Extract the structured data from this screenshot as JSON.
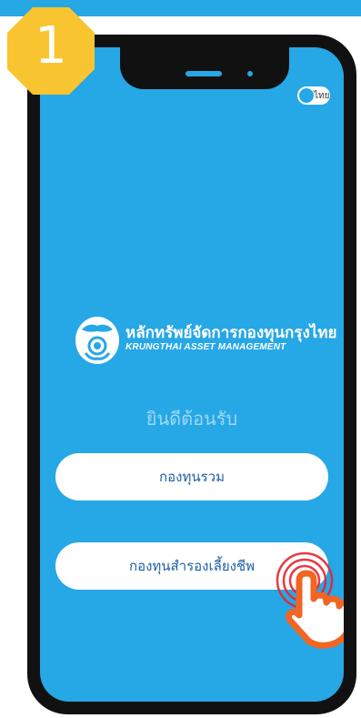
{
  "step": {
    "number": "1"
  },
  "header": {
    "language_toggle": "ไทย"
  },
  "brand": {
    "name_th": "หลักทรัพย์จัดการกองทุนกรุงไทย",
    "name_en": "KRUNGTHAI ASSET MANAGEMENT"
  },
  "welcome_text": "ยินดีต้อนรับ",
  "buttons": {
    "mutual_fund": "กองทุนรวม",
    "provident_fund": "กองทุนสำรองเลี้ยงชีพ"
  },
  "colors": {
    "screen_bg": "#26a7e6",
    "badge": "#f8c430",
    "button_text": "#1f5fa8",
    "hand": "#f26522",
    "ripple": "#e8232d"
  },
  "icons": [
    "krungthai-logo-icon",
    "pointing-hand-icon",
    "tap-ripple-icon"
  ]
}
